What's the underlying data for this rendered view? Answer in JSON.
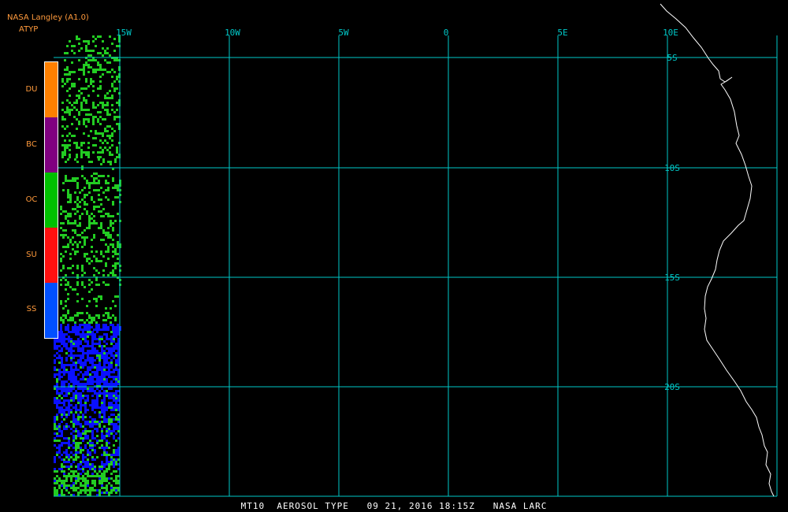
{
  "header": {
    "title": "NASA Langley (A1.0)",
    "product": "ATYP"
  },
  "legend": [
    {
      "label": "DU",
      "color": "#ff8000"
    },
    {
      "label": "BC",
      "color": "#800080"
    },
    {
      "label": "OC",
      "color": "#00c000"
    },
    {
      "label": "SU",
      "color": "#ff1010"
    },
    {
      "label": "SS",
      "color": "#0050ff"
    }
  ],
  "grid": {
    "color": "#00c8c8",
    "longitude_labels": [
      "15W",
      "10W",
      "5W",
      "0",
      "5E",
      "10E"
    ],
    "latitude_labels": [
      "5S",
      "10S",
      "15S",
      "20S"
    ]
  },
  "aerosol_pixel_colors": {
    "green": "#22cc22",
    "blue": "#0a10ff"
  },
  "coastline_color": "#ffffff",
  "caption": "MT10  AEROSOL TYPE   09 21, 2016 18:15Z   NASA LARC"
}
